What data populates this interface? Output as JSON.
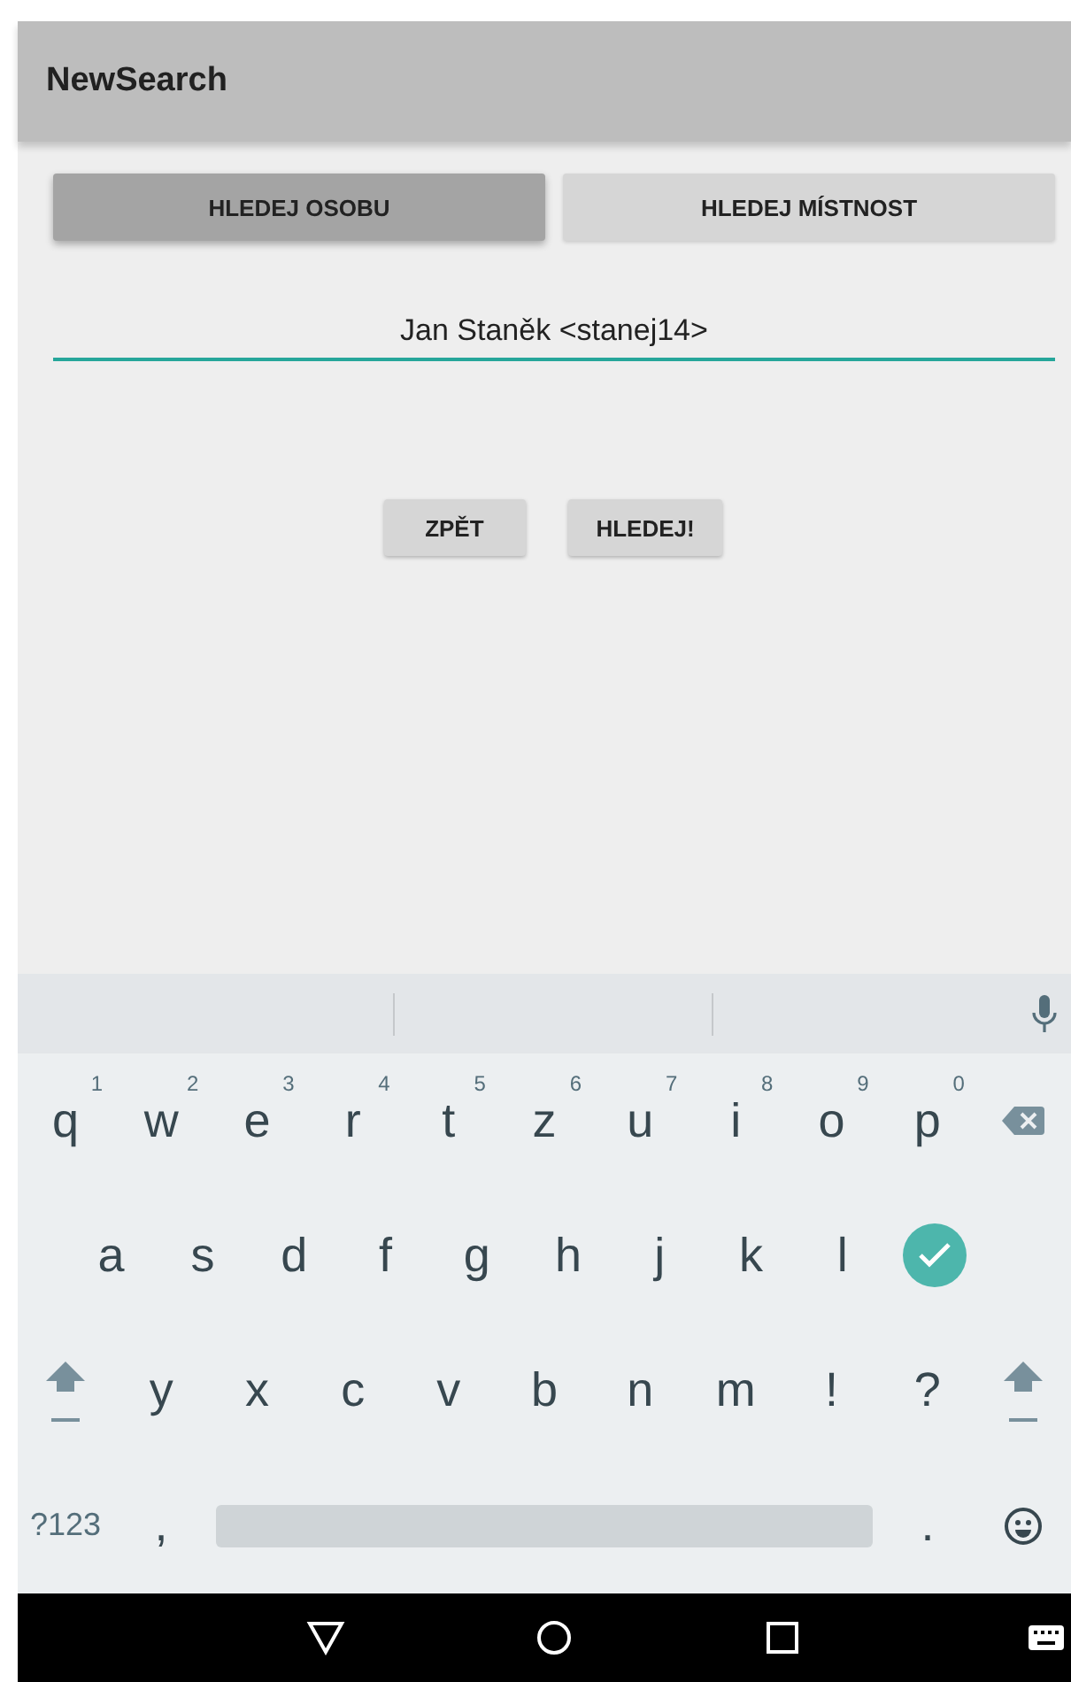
{
  "app_bar": {
    "title": "NewSearch"
  },
  "tabs": [
    {
      "label": "HLEDEJ OSOBU",
      "selected": true
    },
    {
      "label": "HLEDEJ MÍSTNOST",
      "selected": false
    }
  ],
  "search_field": {
    "value": "Jan Staněk <stanej14>"
  },
  "buttons": [
    "ZPĚT",
    "HLEDEJ!"
  ],
  "keyboard": {
    "rows": [
      [
        {
          "kind": "letter",
          "label": "q",
          "hint": "1"
        },
        {
          "kind": "letter",
          "label": "w",
          "hint": "2"
        },
        {
          "kind": "letter",
          "label": "e",
          "hint": "3"
        },
        {
          "kind": "letter",
          "label": "r",
          "hint": "4"
        },
        {
          "kind": "letter",
          "label": "t",
          "hint": "5"
        },
        {
          "kind": "letter",
          "label": "z",
          "hint": "6"
        },
        {
          "kind": "letter",
          "label": "u",
          "hint": "7"
        },
        {
          "kind": "letter",
          "label": "i",
          "hint": "8"
        },
        {
          "kind": "letter",
          "label": "o",
          "hint": "9"
        },
        {
          "kind": "letter",
          "label": "p",
          "hint": "0"
        },
        {
          "kind": "backspace"
        }
      ],
      [
        {
          "kind": "letter",
          "label": "a"
        },
        {
          "kind": "letter",
          "label": "s"
        },
        {
          "kind": "letter",
          "label": "d"
        },
        {
          "kind": "letter",
          "label": "f"
        },
        {
          "kind": "letter",
          "label": "g"
        },
        {
          "kind": "letter",
          "label": "h"
        },
        {
          "kind": "letter",
          "label": "j"
        },
        {
          "kind": "letter",
          "label": "k"
        },
        {
          "kind": "letter",
          "label": "l"
        },
        {
          "kind": "enter"
        }
      ],
      [
        {
          "kind": "shift"
        },
        {
          "kind": "letter",
          "label": "y"
        },
        {
          "kind": "letter",
          "label": "x"
        },
        {
          "kind": "letter",
          "label": "c"
        },
        {
          "kind": "letter",
          "label": "v"
        },
        {
          "kind": "letter",
          "label": "b"
        },
        {
          "kind": "letter",
          "label": "n"
        },
        {
          "kind": "letter",
          "label": "m"
        },
        {
          "kind": "letter",
          "label": "!"
        },
        {
          "kind": "letter",
          "label": "?"
        },
        {
          "kind": "shift"
        }
      ]
    ],
    "bottom_row": {
      "symbols_key": "?123",
      "comma_key": ",",
      "period_key": "."
    }
  }
}
